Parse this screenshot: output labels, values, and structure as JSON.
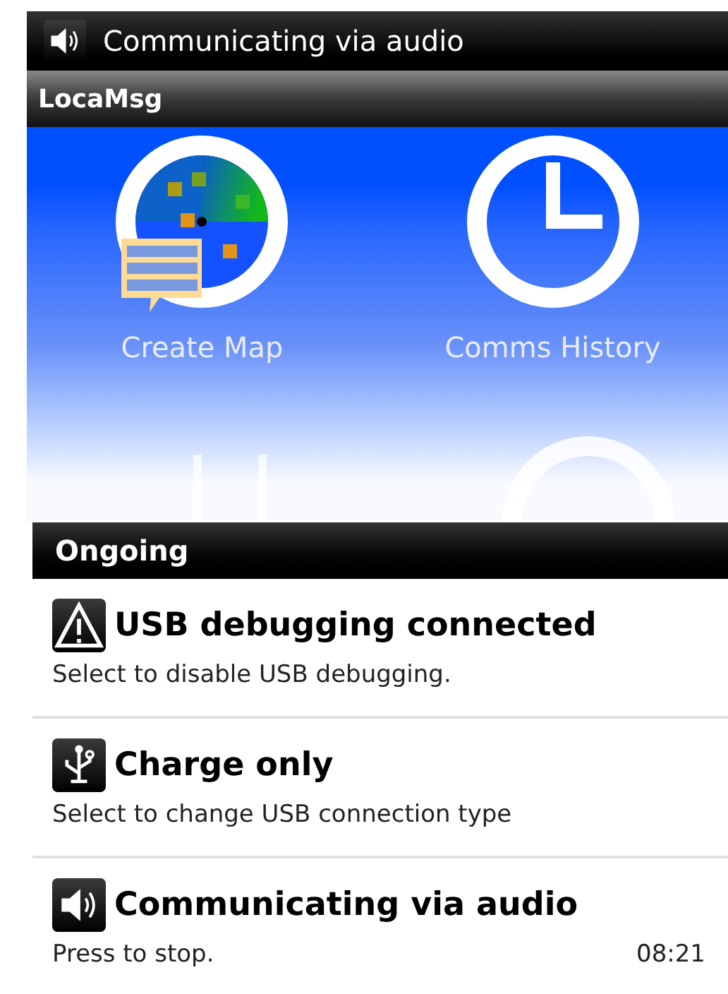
{
  "status_bar": {
    "text": "Communicating via audio"
  },
  "app_bar": {
    "title": "LocaMsg"
  },
  "launcher": [
    {
      "kind": "map",
      "label": "Create Map"
    },
    {
      "kind": "clock",
      "label": "Comms History"
    }
  ],
  "panel": {
    "title": "Ongoing"
  },
  "notifications": [
    {
      "kind": "warning",
      "title": "USB debugging connected",
      "text": "Select to disable USB debugging."
    },
    {
      "kind": "usb",
      "title": "Charge only",
      "text": "Select to change USB connection type"
    },
    {
      "kind": "speaker",
      "title": "Communicating via audio",
      "text": "Press to stop.",
      "time": "08:21"
    }
  ]
}
